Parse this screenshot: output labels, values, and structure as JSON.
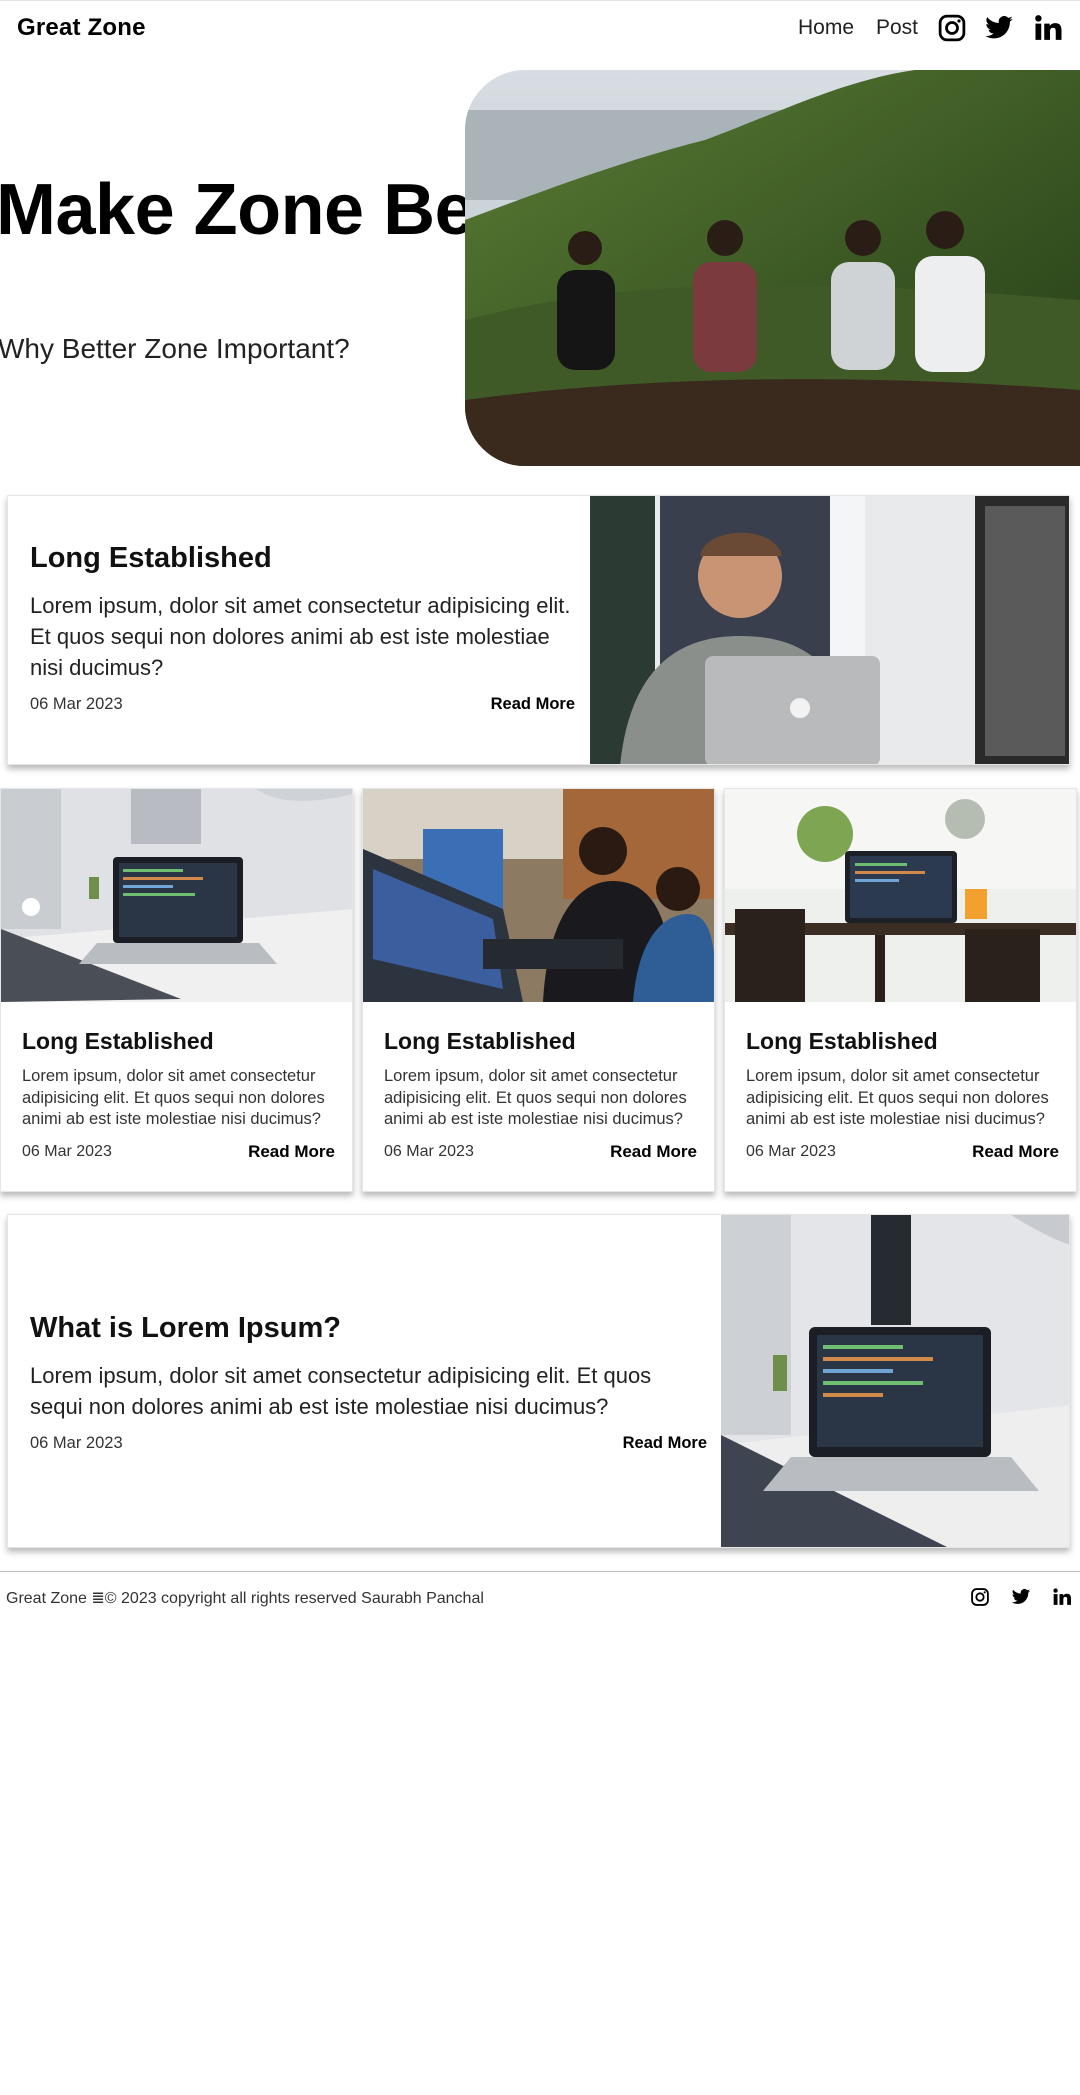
{
  "header": {
    "brand": "Great Zone",
    "nav": [
      {
        "label": "Home"
      },
      {
        "label": "Post"
      }
    ],
    "social_icons": [
      "instagram-icon",
      "twitter-icon",
      "linkedin-icon"
    ]
  },
  "hero": {
    "title": "Make Zone Better!",
    "subtitle": "Why Better Zone Important?",
    "image": "four-friends-on-hillside-photo"
  },
  "featured_post": {
    "title": "Long Established",
    "body": "Lorem ipsum, dolor sit amet consectetur adipisicing elit. Et quos sequi non dolores animi ab est iste molestiae nisi ducimus?",
    "date": "06 Mar 2023",
    "read_more": "Read More",
    "image": "man-with-laptop-photo"
  },
  "posts": [
    {
      "title": "Long Established",
      "body": "Lorem ipsum, dolor sit amet consectetur adipisicing elit. Et quos sequi non dolores animi ab est iste molestiae nisi ducimus?",
      "date": "06 Mar 2023",
      "read_more": "Read More",
      "image": "laptop-on-desk-photo"
    },
    {
      "title": "Long Established",
      "body": "Lorem ipsum, dolor sit amet consectetur adipisicing elit. Et quos sequi non dolores animi ab est iste molestiae nisi ducimus?",
      "date": "06 Mar 2023",
      "read_more": "Read More",
      "image": "people-coding-in-office-photo"
    },
    {
      "title": "Long Established",
      "body": "Lorem ipsum, dolor sit amet consectetur adipisicing elit. Et quos sequi non dolores animi ab est iste molestiae nisi ducimus?",
      "date": "06 Mar 2023",
      "read_more": "Read More",
      "image": "laptop-in-cafe-photo"
    }
  ],
  "bottom_post": {
    "title": "What is Lorem Ipsum?",
    "body": "Lorem ipsum, dolor sit amet consectetur adipisicing elit. Et quos sequi non dolores animi ab est iste molestiae nisi ducimus?",
    "date": "06 Mar 2023",
    "read_more": "Read More",
    "image": "laptop-on-white-desk-photo"
  },
  "footer": {
    "text": "Great Zone ≣© 2023 copyright all rights reserved Saurabh Panchal",
    "social_icons": [
      "instagram-icon",
      "twitter-icon",
      "linkedin-icon"
    ]
  },
  "colors": {
    "text": "#000000",
    "muted_text": "#333333",
    "card_border": "#e6e6e6",
    "footer_rule": "#bdbdbd"
  }
}
